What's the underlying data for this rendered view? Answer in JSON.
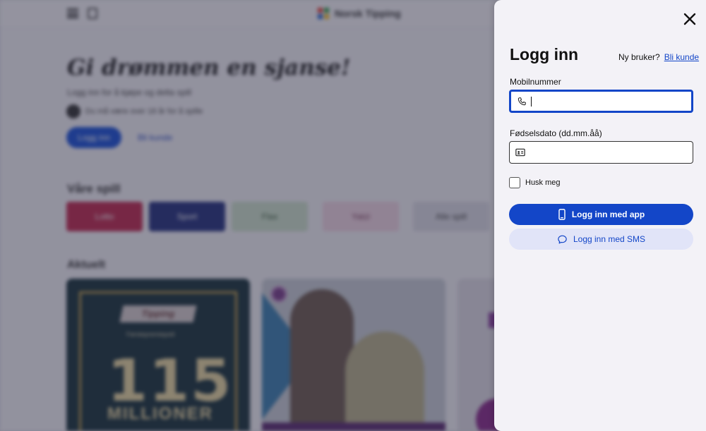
{
  "background": {
    "logo_text": "Norsk Tipping",
    "hero_title": "Gi drømmen en sjanse!",
    "hero_subtitle": "Logg inn for å kjøpe og delta spill",
    "age_badge": "18+",
    "age_text": "Du må være over 18 år for å spille",
    "login_button": "Logg inn",
    "more_link": "Bli kunde",
    "games_heading": "Våre spill",
    "game_tiles": [
      "Lotto",
      "Sport",
      "Flax",
      "Yatzi",
      "Alle spill"
    ],
    "news_heading": "Aktuelt",
    "card1": {
      "ribbon": "Tipping",
      "small_text": "Førstepremiepott",
      "amount": "115",
      "unit": "MILLIONER"
    }
  },
  "drawer": {
    "title": "Logg inn",
    "new_user_prompt": "Ny bruker?",
    "become_customer_link": "Bli kunde",
    "phone_label": "Mobilnummer",
    "phone_value": "",
    "dob_label": "Fødselsdato (dd.mm.åå)",
    "dob_value": "",
    "remember_label": "Husk meg",
    "remember_checked": false,
    "login_app_button": "Logg inn med app",
    "login_sms_button": "Logg inn med SMS"
  },
  "colors": {
    "primary": "#1346c8",
    "secondary_button_bg": "#e1e4f8",
    "drawer_bg": "#f3f2f7"
  },
  "icons": {
    "close": "close-icon",
    "phone": "phone-icon",
    "id_card": "id-card-icon",
    "mobile": "mobile-phone-icon",
    "chat": "chat-bubble-icon"
  }
}
